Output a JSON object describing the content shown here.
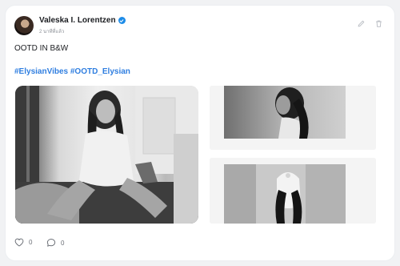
{
  "post": {
    "author": "Valeska I. Lorentzen",
    "time": "2 นาทีที่แล้ว",
    "text": "OOTD IN B&W",
    "hashtags": [
      "#ElysianVibes",
      "#OOTD_Elysian"
    ]
  },
  "reactions": {
    "likes": "0",
    "comments": "0"
  },
  "icons": {
    "verified": "verified-badge-icon",
    "edit": "pencil-icon",
    "delete": "trash-icon",
    "like": "heart-icon",
    "comment": "comment-bubble-icon"
  },
  "colors": {
    "hashtag": "#2f7ee0",
    "verified": "#1d8ce8",
    "background": "#f1f2f4",
    "card": "#ffffff"
  }
}
